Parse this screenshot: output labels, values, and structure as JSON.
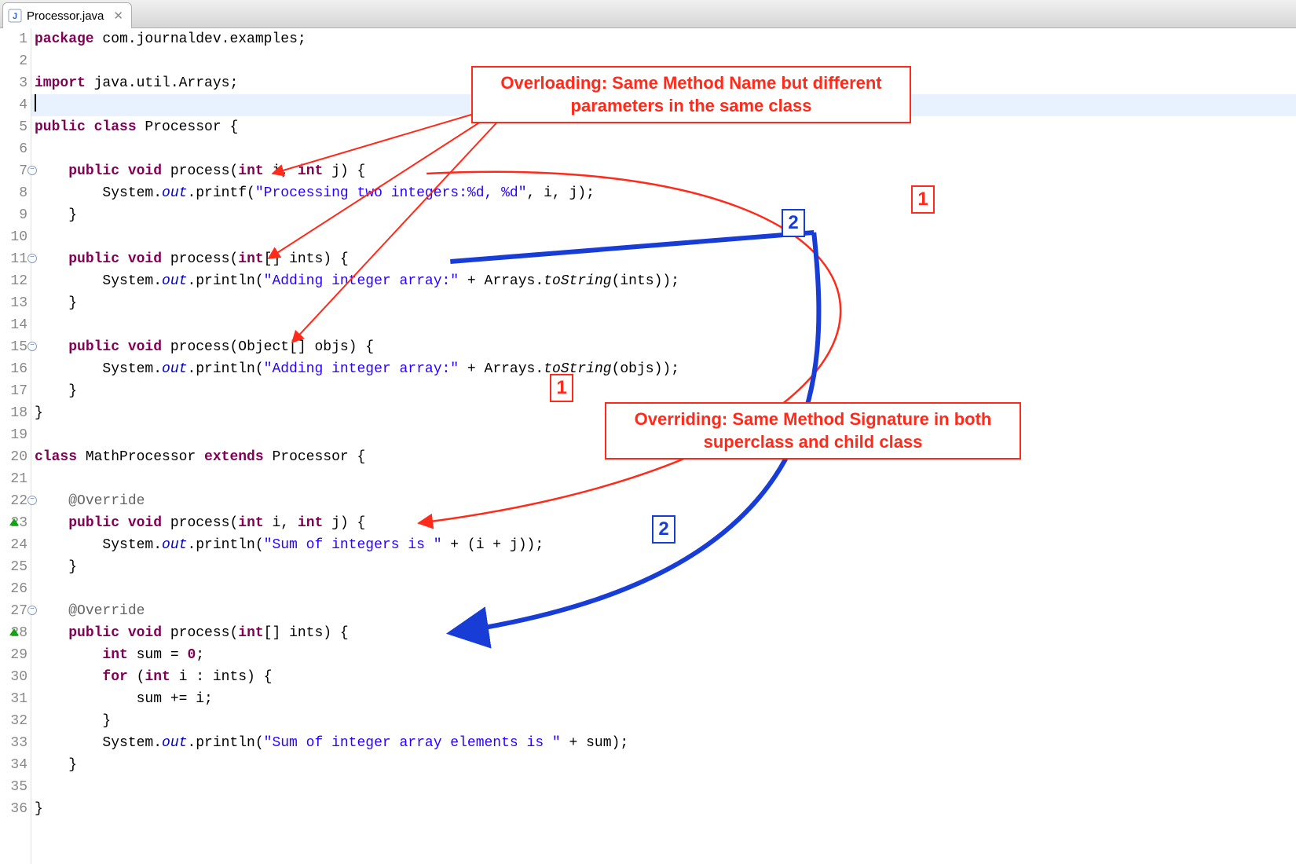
{
  "tab": {
    "title": "Processor.java",
    "close_glyph": "✕"
  },
  "annotations": {
    "overloading": "Overloading: Same Method Name but different parameters in the same class",
    "overriding": "Overriding: Same Method Signature in both superclass and child class",
    "labels": {
      "pair1": "1",
      "pair2": "2"
    }
  },
  "code": [
    {
      "n": 1,
      "tokens": [
        [
          "kw",
          "package"
        ],
        [
          "",
          " com.journaldev.examples;"
        ]
      ]
    },
    {
      "n": 2,
      "tokens": []
    },
    {
      "n": 3,
      "tokens": [
        [
          "kw",
          "import"
        ],
        [
          "",
          " java.util.Arrays;"
        ]
      ]
    },
    {
      "n": 4,
      "tokens": [],
      "current": true,
      "cursor": true
    },
    {
      "n": 5,
      "tokens": [
        [
          "kw",
          "public class"
        ],
        [
          "",
          " Processor {"
        ]
      ]
    },
    {
      "n": 6,
      "tokens": []
    },
    {
      "n": 7,
      "tokens": [
        [
          "",
          "    "
        ],
        [
          "kw",
          "public void"
        ],
        [
          "",
          " process("
        ],
        [
          "kw",
          "int"
        ],
        [
          "",
          " i, "
        ],
        [
          "kw",
          "int"
        ],
        [
          "",
          " j) {"
        ]
      ],
      "fold": true
    },
    {
      "n": 8,
      "tokens": [
        [
          "",
          "        System."
        ],
        [
          "static-field",
          "out"
        ],
        [
          "",
          ".printf("
        ],
        [
          "str",
          "\"Processing two integers:%d, %d\""
        ],
        [
          "",
          ", i, j);"
        ]
      ]
    },
    {
      "n": 9,
      "tokens": [
        [
          "",
          "    }"
        ]
      ]
    },
    {
      "n": 10,
      "tokens": []
    },
    {
      "n": 11,
      "tokens": [
        [
          "",
          "    "
        ],
        [
          "kw",
          "public void"
        ],
        [
          "",
          " process("
        ],
        [
          "kw",
          "int"
        ],
        [
          "",
          "[] ints) {"
        ]
      ],
      "fold": true
    },
    {
      "n": 12,
      "tokens": [
        [
          "",
          "        System."
        ],
        [
          "static-field",
          "out"
        ],
        [
          "",
          ".println("
        ],
        [
          "str",
          "\"Adding integer array:\""
        ],
        [
          "",
          " + Arrays."
        ],
        [
          "static-method",
          "toString"
        ],
        [
          "",
          "(ints));"
        ]
      ]
    },
    {
      "n": 13,
      "tokens": [
        [
          "",
          "    }"
        ]
      ]
    },
    {
      "n": 14,
      "tokens": []
    },
    {
      "n": 15,
      "tokens": [
        [
          "",
          "    "
        ],
        [
          "kw",
          "public void"
        ],
        [
          "",
          " process(Object[] objs) {"
        ]
      ],
      "fold": true
    },
    {
      "n": 16,
      "tokens": [
        [
          "",
          "        System."
        ],
        [
          "static-field",
          "out"
        ],
        [
          "",
          ".println("
        ],
        [
          "str",
          "\"Adding integer array:\""
        ],
        [
          "",
          " + Arrays."
        ],
        [
          "static-method",
          "toString"
        ],
        [
          "",
          "(objs));"
        ]
      ]
    },
    {
      "n": 17,
      "tokens": [
        [
          "",
          "    }"
        ]
      ]
    },
    {
      "n": 18,
      "tokens": [
        [
          "",
          "}"
        ]
      ]
    },
    {
      "n": 19,
      "tokens": []
    },
    {
      "n": 20,
      "tokens": [
        [
          "kw",
          "class"
        ],
        [
          "",
          " MathProcessor "
        ],
        [
          "kw",
          "extends"
        ],
        [
          "",
          " Processor {"
        ]
      ]
    },
    {
      "n": 21,
      "tokens": []
    },
    {
      "n": 22,
      "tokens": [
        [
          "",
          "    "
        ],
        [
          "comment",
          "@Override"
        ]
      ],
      "fold": true
    },
    {
      "n": 23,
      "tokens": [
        [
          "",
          "    "
        ],
        [
          "kw",
          "public void"
        ],
        [
          "",
          " process("
        ],
        [
          "kw",
          "int"
        ],
        [
          "",
          " i, "
        ],
        [
          "kw",
          "int"
        ],
        [
          "",
          " j) {"
        ]
      ],
      "override": true
    },
    {
      "n": 24,
      "tokens": [
        [
          "",
          "        System."
        ],
        [
          "static-field",
          "out"
        ],
        [
          "",
          ".println("
        ],
        [
          "str",
          "\"Sum of integers is \""
        ],
        [
          "",
          " + (i + j));"
        ]
      ]
    },
    {
      "n": 25,
      "tokens": [
        [
          "",
          "    }"
        ]
      ]
    },
    {
      "n": 26,
      "tokens": []
    },
    {
      "n": 27,
      "tokens": [
        [
          "",
          "    "
        ],
        [
          "comment",
          "@Override"
        ]
      ],
      "fold": true
    },
    {
      "n": 28,
      "tokens": [
        [
          "",
          "    "
        ],
        [
          "kw",
          "public void"
        ],
        [
          "",
          " process("
        ],
        [
          "kw",
          "int"
        ],
        [
          "",
          "[] ints) {"
        ]
      ],
      "override": true
    },
    {
      "n": 29,
      "tokens": [
        [
          "",
          "        "
        ],
        [
          "kw",
          "int"
        ],
        [
          "",
          " sum = "
        ],
        [
          "kw",
          "0"
        ],
        [
          "",
          ";"
        ]
      ]
    },
    {
      "n": 30,
      "tokens": [
        [
          "",
          "        "
        ],
        [
          "kw",
          "for"
        ],
        [
          "",
          " ("
        ],
        [
          "kw",
          "int"
        ],
        [
          "",
          " i : ints) {"
        ]
      ]
    },
    {
      "n": 31,
      "tokens": [
        [
          "",
          "            sum += i;"
        ]
      ]
    },
    {
      "n": 32,
      "tokens": [
        [
          "",
          "        }"
        ]
      ]
    },
    {
      "n": 33,
      "tokens": [
        [
          "",
          "        System."
        ],
        [
          "static-field",
          "out"
        ],
        [
          "",
          ".println("
        ],
        [
          "str",
          "\"Sum of integer array elements is \""
        ],
        [
          "",
          " + sum);"
        ]
      ]
    },
    {
      "n": 34,
      "tokens": [
        [
          "",
          "    }"
        ]
      ]
    },
    {
      "n": 35,
      "tokens": []
    },
    {
      "n": 36,
      "tokens": [
        [
          "",
          "}"
        ]
      ]
    }
  ]
}
